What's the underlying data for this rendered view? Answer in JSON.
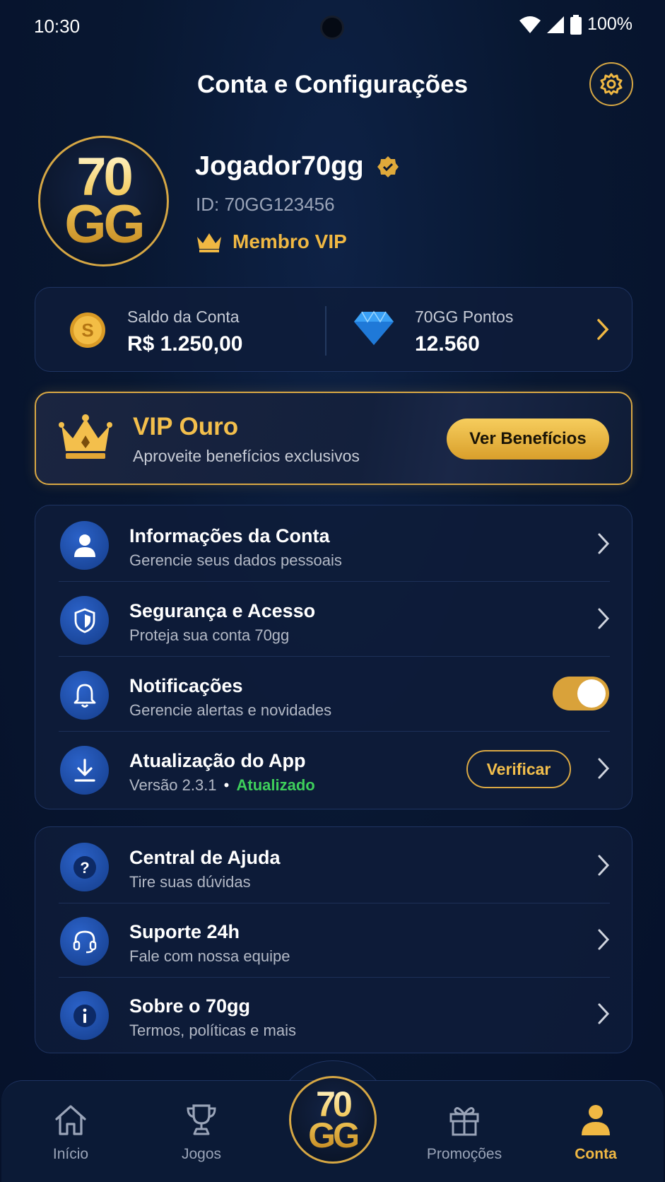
{
  "status_bar": {
    "time": "10:30",
    "battery": "100%"
  },
  "header": {
    "title": "Conta e Configurações"
  },
  "profile": {
    "logo_top": "70",
    "logo_bottom": "GG",
    "username": "Jogador70gg",
    "user_id": "ID: 70GG123456",
    "vip_label": "Membro VIP"
  },
  "balance": {
    "account_label": "Saldo da Conta",
    "account_value": "R$ 1.250,00",
    "points_label": "70GG Pontos",
    "points_value": "12.560"
  },
  "vip_card": {
    "title": "VIP Ouro",
    "subtitle": "Aproveite benefícios exclusivos",
    "button_label": "Ver Benefícios"
  },
  "settings": [
    {
      "title": "Informações da Conta",
      "subtitle": "Gerencie seus dados pessoais",
      "icon": "user-icon"
    },
    {
      "title": "Segurança e Acesso",
      "subtitle": "Proteja sua conta 70gg",
      "icon": "shield-icon"
    },
    {
      "title": "Notificações",
      "subtitle": "Gerencie alertas e novidades",
      "icon": "bell-icon",
      "toggle_on": true
    },
    {
      "title": "Atualização do App",
      "subtitle_version": "Versão 2.3.1",
      "subtitle_sep": "•",
      "subtitle_status": "Atualizado",
      "button_label": "Verificar",
      "icon": "download-icon"
    }
  ],
  "support": [
    {
      "title": "Central de Ajuda",
      "subtitle": "Tire suas dúvidas",
      "icon": "question-icon"
    },
    {
      "title": "Suporte 24h",
      "subtitle": "Fale com nossa equipe",
      "icon": "headset-icon"
    },
    {
      "title": "Sobre o 70gg",
      "subtitle": "Termos, políticas e mais",
      "icon": "info-icon"
    }
  ],
  "nav": {
    "items": [
      {
        "label": "Início",
        "icon": "home-icon"
      },
      {
        "label": "Jogos",
        "icon": "trophy-icon"
      },
      {
        "label": "Promoções",
        "icon": "gift-icon"
      },
      {
        "label": "Conta",
        "icon": "user-icon",
        "active": true
      }
    ],
    "center_logo_top": "70",
    "center_logo_bottom": "GG"
  },
  "colors": {
    "gold": "#f0b843",
    "background": "#081731",
    "card": "#0e1c3a",
    "icon_blue": "#2b62c9",
    "success": "#3ecf5b"
  }
}
